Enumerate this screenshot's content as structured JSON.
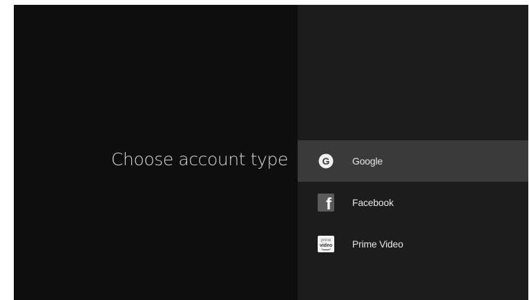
{
  "prompt": {
    "title": "Choose account type"
  },
  "account_types": [
    {
      "label": "Google",
      "icon": "google-icon",
      "selected": true
    },
    {
      "label": "Facebook",
      "icon": "facebook-icon",
      "selected": false
    },
    {
      "label": "Prime Video",
      "icon": "prime-video-icon",
      "selected": false,
      "icon_text": [
        "prime",
        "video"
      ]
    }
  ],
  "colors": {
    "left_background": "#0e0e0e",
    "right_background": "#1c1c1c",
    "selected_row": "#3a3a3a",
    "text": "#e6e6e6"
  }
}
